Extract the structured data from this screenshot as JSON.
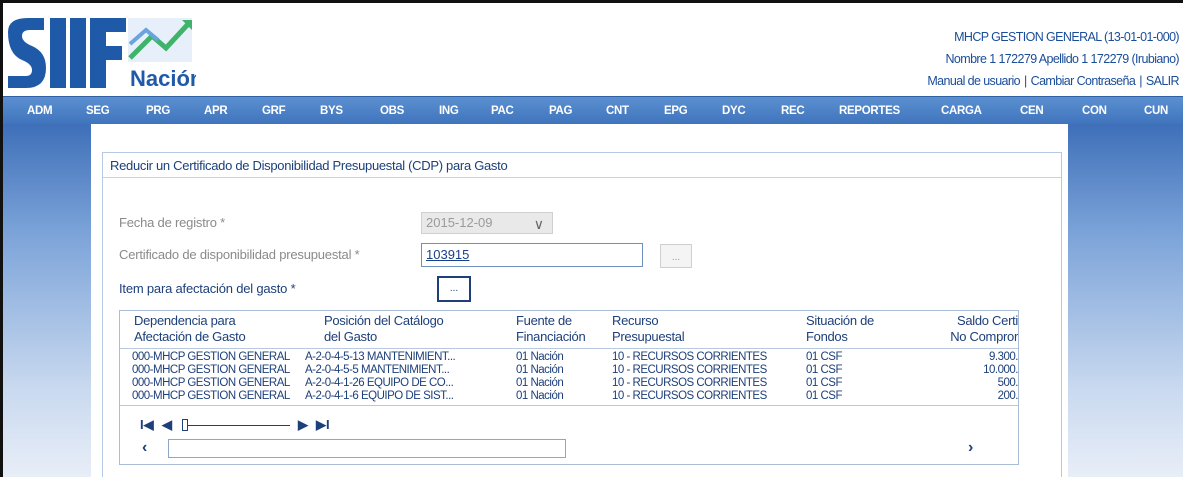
{
  "header": {
    "logo_text": "SIIF",
    "logo_sub": "Nación",
    "user_org": "MHCP GESTION GENERAL (13-01-01-000)",
    "user_name": "Nombre 1 172279 Apellido 1 172279 (Irubiano)",
    "link_manual": "Manual de usuario",
    "link_password": "Cambiar Contraseña",
    "link_exit": "SALIR",
    "brand_color": "#1a4d99"
  },
  "menu": [
    "ADM",
    "SEG",
    "PRG",
    "APR",
    "GRF",
    "BYS",
    "OBS",
    "ING",
    "PAC",
    "PAG",
    "CNT",
    "EPG",
    "DYC",
    "REC",
    "REPORTES",
    "CARGA",
    "CEN",
    "CON",
    "CUN"
  ],
  "form": {
    "title": "Reducir un Certificado de Disponibilidad Presupuestal (CDP) para Gasto",
    "fecha_label": "Fecha de registro *",
    "fecha_value": "2015-12-09",
    "cdp_label": "Certificado de disponibilidad presupuestal *",
    "cdp_value": "103915",
    "item_label": "Item para afectación del gasto *",
    "dots": "..."
  },
  "grid": {
    "headers": [
      [
        "Dependencia para",
        "Afectación de Gasto"
      ],
      [
        "Posición del Catálogo",
        "del Gasto"
      ],
      [
        "Fuente de",
        "Financiación"
      ],
      [
        "Recurso",
        "Presupuestal"
      ],
      [
        "Situación de",
        "Fondos"
      ],
      [
        "Saldo Certi",
        "No Compror"
      ]
    ],
    "rows": [
      [
        "000-MHCP GESTION GENERAL",
        "A-2-0-4-5-13 MANTENIMIENT...",
        "01 Nación",
        "10 - RECURSOS CORRIENTES",
        "01 CSF",
        "9.300."
      ],
      [
        "000-MHCP GESTION GENERAL",
        "A-2-0-4-5-5 MANTENIMIENT...",
        "01 Nación",
        "10 - RECURSOS CORRIENTES",
        "01 CSF",
        "10.000."
      ],
      [
        "000-MHCP GESTION GENERAL",
        "A-2-0-4-1-26 EQUIPO DE CO...",
        "01 Nación",
        "10 - RECURSOS CORRIENTES",
        "01 CSF",
        "500."
      ],
      [
        "000-MHCP GESTION GENERAL",
        "A-2-0-4-1-6 EQUIPO DE SIST...",
        "01 Nación",
        "10 - RECURSOS CORRIENTES",
        "01 CSF",
        "200."
      ]
    ],
    "pager": {
      "first": "I◀",
      "prev": "◀",
      "next": "▶",
      "last": "▶I"
    },
    "scroll": {
      "left": "‹",
      "right": "›"
    }
  }
}
